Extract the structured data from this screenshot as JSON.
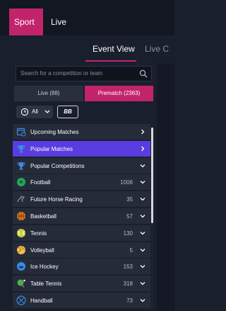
{
  "top_tabs": {
    "sport": "Sport",
    "live": "Live"
  },
  "view_tabs": {
    "event_view": "Event View",
    "live_partial": "Live C"
  },
  "search": {
    "placeholder": "Search for a competition or team"
  },
  "segments": {
    "live": "Live (88)",
    "prematch": "Prematch (2363)"
  },
  "filters": {
    "time_selected": "All",
    "bb_label": "BB"
  },
  "colors": {
    "accent": "#c2246b",
    "active_row": "#5a3de0"
  },
  "rows": [
    {
      "label": "Upcoming Matches",
      "count": "",
      "icon": "calendar-clock-icon",
      "chevron": "right"
    },
    {
      "label": "Popular Matches",
      "count": "",
      "icon": "trophy-icon",
      "chevron": "right"
    },
    {
      "label": "Popular Competitions",
      "count": "",
      "icon": "trophy-icon",
      "chevron": "down"
    },
    {
      "label": "Football",
      "count": "1006",
      "icon": "football-icon",
      "chevron": "down"
    },
    {
      "label": "Future Horse Racing",
      "count": "35",
      "icon": "horse-icon",
      "chevron": "down"
    },
    {
      "label": "Basketball",
      "count": "57",
      "icon": "basketball-icon",
      "chevron": "down"
    },
    {
      "label": "Tennis",
      "count": "130",
      "icon": "tennis-ball-icon",
      "chevron": "down"
    },
    {
      "label": "Volleyball",
      "count": "5",
      "icon": "volleyball-icon",
      "chevron": "down"
    },
    {
      "label": "Ice Hockey",
      "count": "153",
      "icon": "ice-hockey-icon",
      "chevron": "down"
    },
    {
      "label": "Table Tennis",
      "count": "318",
      "icon": "table-tennis-icon",
      "chevron": "down"
    },
    {
      "label": "Handball",
      "count": "73",
      "icon": "handball-icon",
      "chevron": "down"
    }
  ]
}
